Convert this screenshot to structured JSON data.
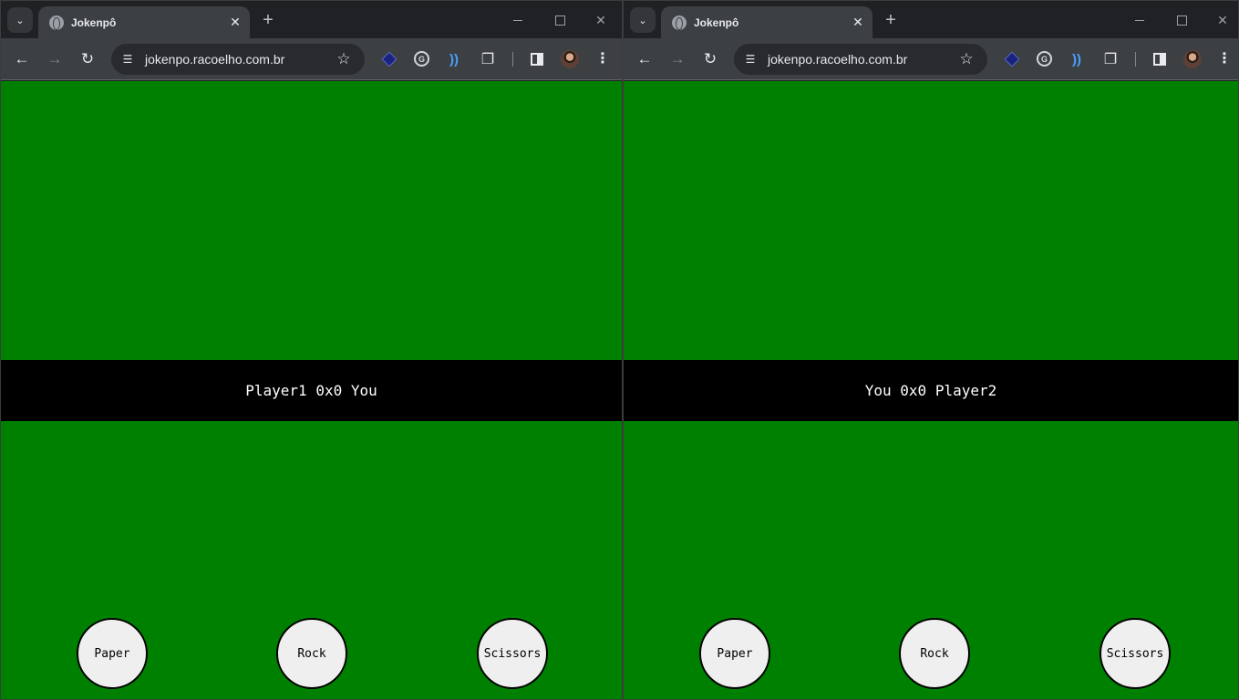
{
  "windows": [
    {
      "tab_title": "Jokenpô",
      "url": "jokenpo.racoelho.com.br",
      "score": "Player1 0x0 You",
      "buttons": {
        "paper": "Paper",
        "rock": "Rock",
        "scissors": "Scissors"
      }
    },
    {
      "tab_title": "Jokenpô",
      "url": "jokenpo.racoelho.com.br",
      "score": "You 0x0 Player2",
      "buttons": {
        "paper": "Paper",
        "rock": "Rock",
        "scissors": "Scissors"
      }
    }
  ],
  "icons": {
    "tab_search": "chevron-down-icon",
    "tab_favicon": "globe-icon",
    "tab_close": "close-icon",
    "new_tab": "plus-icon",
    "back": "arrow-left-icon",
    "forward": "arrow-right-icon",
    "reload": "reload-icon",
    "site_info": "tune-icon",
    "bookmark": "star-icon",
    "extensions": [
      "diamond-extension-icon",
      "password-extension-icon",
      "wave-extension-icon",
      "puzzle-icon"
    ],
    "side_panel": "side-panel-icon",
    "profile": "avatar",
    "menu": "kebab-menu-icon"
  },
  "colors": {
    "page_background": "#008000",
    "score_bar": "#000000",
    "score_text": "#ffffff",
    "button_fill": "#efefef"
  }
}
